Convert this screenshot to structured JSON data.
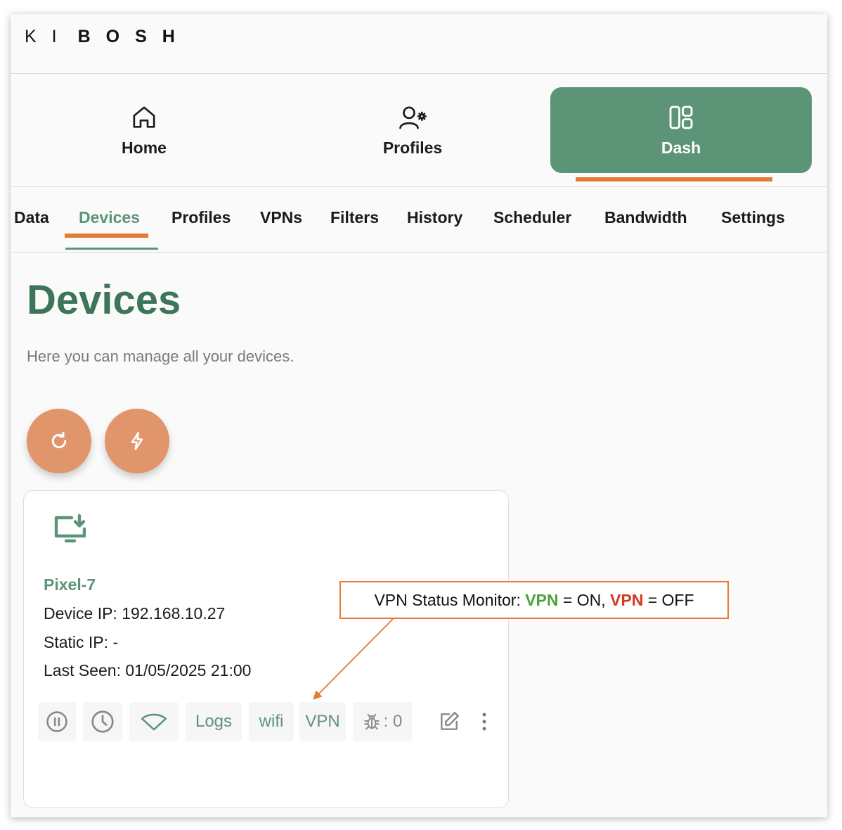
{
  "logo": {
    "light": "KI",
    "bold": "BOSH"
  },
  "main_nav": [
    {
      "label": "Home",
      "icon": "home-icon",
      "active": false
    },
    {
      "label": "Profiles",
      "icon": "user-gear-icon",
      "active": false
    },
    {
      "label": "Dash",
      "icon": "dashboard-grid-icon",
      "active": true
    }
  ],
  "sub_nav": [
    "Data",
    "Devices",
    "Profiles",
    "VPNs",
    "Filters",
    "History",
    "Scheduler",
    "Bandwidth",
    "Settings"
  ],
  "sub_nav_active": "Devices",
  "page": {
    "title": "Devices",
    "subtitle": "Here you can manage all your devices."
  },
  "fab_buttons": [
    {
      "name": "refresh",
      "icon": "refresh-icon"
    },
    {
      "name": "lightning",
      "icon": "lightning-icon"
    }
  ],
  "device": {
    "icon": "monitor-download-icon",
    "name": "Pixel-7",
    "device_ip_label": "Device IP:",
    "device_ip": "192.168.10.27",
    "static_ip_label": "Static IP:",
    "static_ip": "-",
    "last_seen_label": "Last Seen:",
    "last_seen": "01/05/2025 21:00",
    "actions": {
      "logs": "Logs",
      "wifi": "wifi",
      "vpn": "VPN",
      "bug_count": ": 0"
    }
  },
  "callout": {
    "prefix": "VPN Status Monitor:",
    "on_word": "VPN",
    "on_text": "= ON,",
    "off_word": "VPN",
    "off_text": "= OFF"
  },
  "colors": {
    "brand_green": "#5c9478",
    "title_green": "#3d7558",
    "accent_orange": "#e37b36",
    "fab_orange": "#e0956b",
    "vpn_on": "#4aa33a",
    "vpn_off": "#d4381f"
  }
}
